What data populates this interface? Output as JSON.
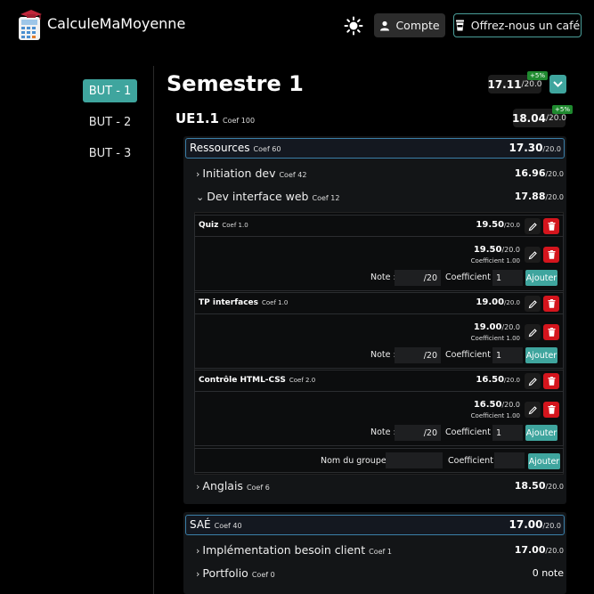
{
  "header": {
    "brand": "CalculeMaMoyenne",
    "account_label": "Compte",
    "coffee_label": "Offrez-nous un café"
  },
  "sidebar": {
    "items": [
      {
        "label": "BUT - 1",
        "active": true
      },
      {
        "label": "BUT - 2",
        "active": false
      },
      {
        "label": "BUT - 3",
        "active": false
      }
    ]
  },
  "semester": {
    "title": "Semestre 1",
    "grade": "17.11",
    "denominator": "/20.0",
    "bonus": "+5%"
  },
  "ue": {
    "title": "UE1.1",
    "coef": "Coef 100",
    "grade": "18.04",
    "denominator": "/20.0",
    "bonus": "+5%"
  },
  "ressources": {
    "label": "Ressources",
    "coef": "Coef 60",
    "grade": "17.30",
    "denominator": "/20.0",
    "subjects": [
      {
        "name": "Initiation dev",
        "coef": "Coef 42",
        "grade": "16.96",
        "denominator": "/20.0",
        "chevron": "›"
      },
      {
        "name": "Dev interface web",
        "coef": "Coef 12",
        "grade": "17.88",
        "denominator": "/20.0",
        "chevron": "⌄"
      },
      {
        "name": "Anglais",
        "coef": "Coef 6",
        "grade": "18.50",
        "denominator": "/20.0",
        "chevron": "›"
      }
    ],
    "evaluations": [
      {
        "name": "Quiz",
        "coef": "Coef 1.0",
        "grade": "19.50",
        "denominator": "/20.0",
        "entry_grade": "19.50",
        "entry_coef": "Coefficient 1.00"
      },
      {
        "name": "TP interfaces",
        "coef": "Coef 1.0",
        "grade": "19.00",
        "denominator": "/20.0",
        "entry_grade": "19.00",
        "entry_coef": "Coefficient 1.00"
      },
      {
        "name": "Contrôle HTML-CSS",
        "coef": "Coef 2.0",
        "grade": "16.50",
        "denominator": "/20.0",
        "entry_grade": "16.50",
        "entry_coef": "Coefficient 1.00"
      }
    ],
    "form": {
      "note_label": "Note :",
      "note_suffix": "/20",
      "coef_label": "Coefficient :",
      "coef_value": "1",
      "add_label": "Ajouter"
    },
    "group_form": {
      "name_label": "Nom du groupe :",
      "coef_label": "Coefficient :",
      "add_label": "Ajouter"
    }
  },
  "sae": {
    "label": "SAÉ",
    "coef": "Coef 40",
    "grade": "17.00",
    "denominator": "/20.0",
    "subjects": [
      {
        "name": "Implémentation besoin client",
        "coef": "Coef 1",
        "grade": "17.00",
        "denominator": "/20.0",
        "chevron": "›"
      },
      {
        "name": "Portfolio",
        "coef": "Coef 0",
        "grade": "0 note",
        "denominator": "",
        "chevron": "›"
      }
    ]
  },
  "colors": {
    "accent": "#3fa59e",
    "danger": "#d4151d",
    "bonus": "#1f8a2f",
    "section_border": "#3b7fa8"
  }
}
